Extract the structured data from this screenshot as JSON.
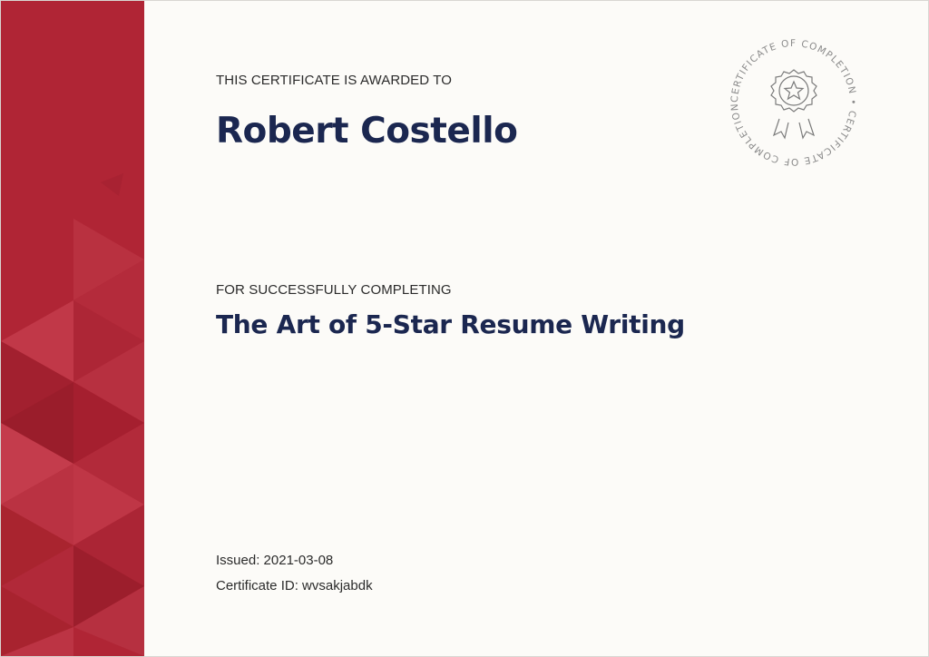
{
  "certificate": {
    "awarded_label": "THIS CERTIFICATE IS AWARDED TO",
    "recipient_name": "Robert Costello",
    "completing_label": "FOR SUCCESSFULLY COMPLETING",
    "course_title": "The Art of 5-Star Resume Writing",
    "issued_label": "Issued:",
    "issued_date": "2021-03-08",
    "certificate_id_label": "Certificate ID:",
    "certificate_id": "wvsakjabdk"
  },
  "seal": {
    "text": "CERTIFICATE OF COMPLETION • CERTIFICATE OF COMPLETION •",
    "icon": "award-ribbon-star-icon"
  },
  "colors": {
    "band": "#b02535",
    "text_dark": "#1b2750",
    "seal_gray": "#8a8a8a"
  }
}
